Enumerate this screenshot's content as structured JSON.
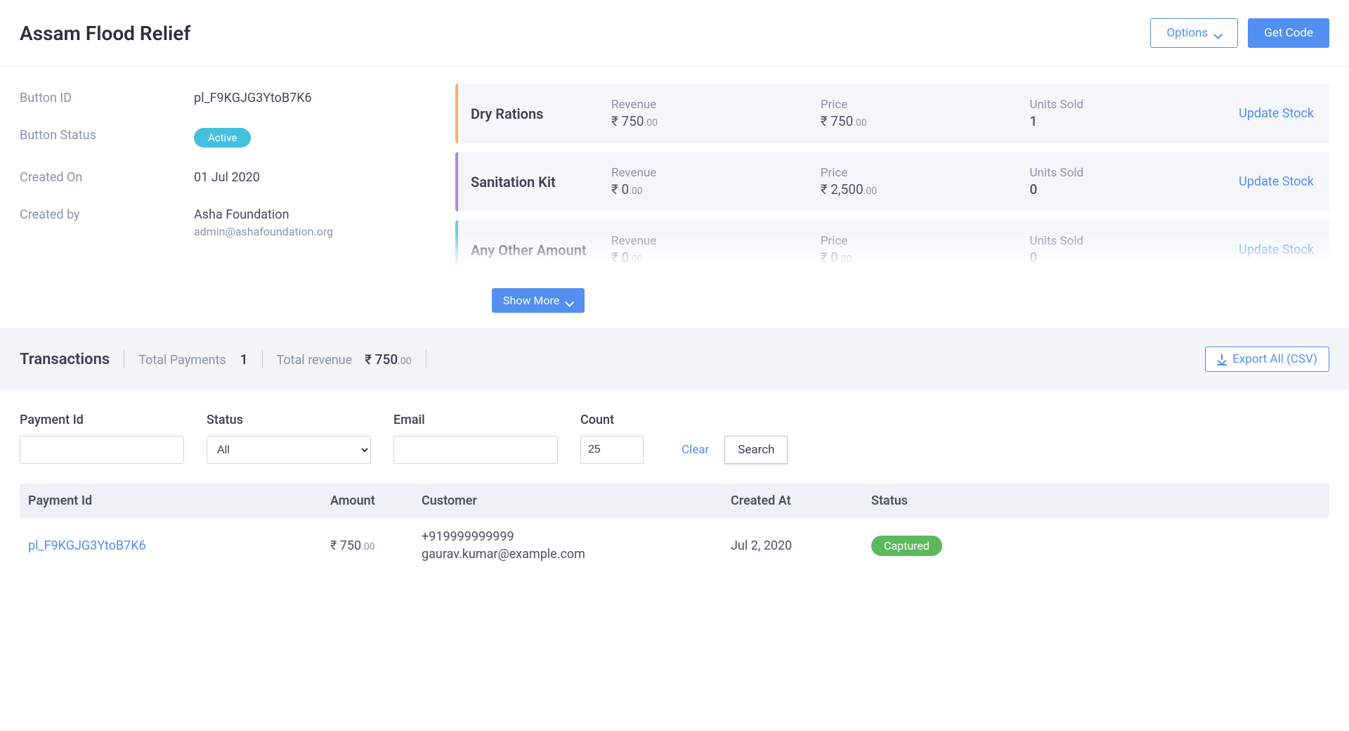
{
  "header": {
    "title": "Assam Flood Relief",
    "options_label": "Options",
    "get_code_label": "Get Code"
  },
  "details": {
    "button_id_label": "Button ID",
    "button_id": "pl_F9KGJG3YtoB7K6",
    "button_status_label": "Button Status",
    "button_status": "Active",
    "created_on_label": "Created On",
    "created_on": "01 Jul 2020",
    "created_by_label": "Created by",
    "created_by_name": "Asha Foundation",
    "created_by_email": "admin@ashafoundation.org"
  },
  "products": [
    {
      "name": "Dry Rations",
      "revenue_label": "Revenue",
      "revenue_int": "₹ 750",
      "revenue_dec": ".00",
      "price_label": "Price",
      "price_int": "₹ 750",
      "price_dec": ".00",
      "units_label": "Units Sold",
      "units": "1",
      "update_label": "Update Stock"
    },
    {
      "name": "Sanitation Kit",
      "revenue_label": "Revenue",
      "revenue_int": "₹ 0",
      "revenue_dec": ".00",
      "price_label": "Price",
      "price_int": "₹ 2,500",
      "price_dec": ".00",
      "units_label": "Units Sold",
      "units": "0",
      "update_label": "Update Stock"
    },
    {
      "name": "Any Other Amount",
      "revenue_label": "Revenue",
      "revenue_int": "₹ 0",
      "revenue_dec": ".00",
      "price_label": "Price",
      "price_int": "₹ 0",
      "price_dec": ".00",
      "units_label": "Units Sold",
      "units": "0",
      "update_label": "Update Stock"
    }
  ],
  "show_more_label": "Show More",
  "transactions": {
    "title": "Transactions",
    "total_payments_label": "Total Payments",
    "total_payments": "1",
    "total_revenue_label": "Total revenue",
    "total_revenue_int": "₹ 750",
    "total_revenue_dec": ".00",
    "export_label": "Export All (CSV)"
  },
  "filters": {
    "payment_id_label": "Payment Id",
    "payment_id_value": "",
    "status_label": "Status",
    "status_selected": "All",
    "email_label": "Email",
    "email_value": "",
    "count_label": "Count",
    "count_value": "25",
    "clear_label": "Clear",
    "search_label": "Search"
  },
  "table": {
    "columns": {
      "payment_id": "Payment Id",
      "amount": "Amount",
      "customer": "Customer",
      "created_at": "Created At",
      "status": "Status"
    },
    "rows": [
      {
        "payment_id": "pl_F9KGJG3YtoB7K6",
        "amount_int": "₹ 750",
        "amount_dec": ".00",
        "customer_phone": "+919999999999",
        "customer_email": "gaurav.kumar@example.com",
        "created_at": "Jul 2, 2020",
        "status": "Captured"
      }
    ]
  }
}
